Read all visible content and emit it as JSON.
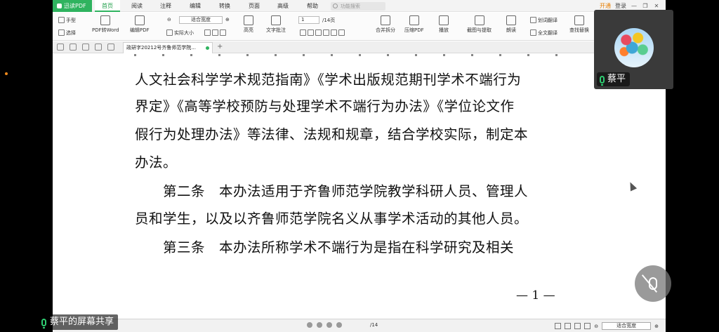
{
  "menubar": {
    "brand": "迅读PDF",
    "tabs": [
      "首页",
      "阅读",
      "注释",
      "编辑",
      "转换",
      "页面",
      "高级",
      "帮助"
    ],
    "active_tab": "首页",
    "search_placeholder": "功能搜索",
    "open_vip": "开通",
    "login": "登录"
  },
  "ribbon": {
    "hand_tool": "手型",
    "select_tool": "选择",
    "pdf_to_word": "PDF转Word",
    "edit_pdf": "编辑PDF",
    "zoom_mode": "适合宽度",
    "actual_size": "实际大小",
    "highlight": "高亮",
    "text_note": "文字批注",
    "page_current": "1",
    "page_total": "/14页",
    "merge_split": "合并拆分",
    "compress_pdf": "压缩PDF",
    "play": "播放",
    "screenshot_extract": "截图与提取",
    "read_aloud": "朗读",
    "word_translate": "划词翻译",
    "full_translate": "全文翻译",
    "find_replace": "查找替换"
  },
  "tabbar": {
    "doc_tab": "政研字20212号齐鲁师范学院..."
  },
  "document": {
    "lines": [
      "人文社会科学学术规范指南》《学术出版规范期刊学术不端行为",
      "界定》《高等学校预防与处理学术不端行为办法》《学位论文作",
      "假行为处理办法》等法律、法规和规章，结合学校实际，制定本",
      "办法。",
      "　　第二条　本办法适用于齐鲁师范学院教学科研人员、管理人",
      "员和学生，以及以齐鲁师范学院名义从事学术活动的其他人员。",
      "　　第三条　本办法所称学术不端行为是指在科学研究及相关"
    ],
    "page_number": "— 1 —"
  },
  "statusbar": {
    "page": "/14",
    "zoom": "适合宽度"
  },
  "meeting": {
    "participant_name": "蔡平",
    "share_label": "蔡平的屏幕共享"
  }
}
